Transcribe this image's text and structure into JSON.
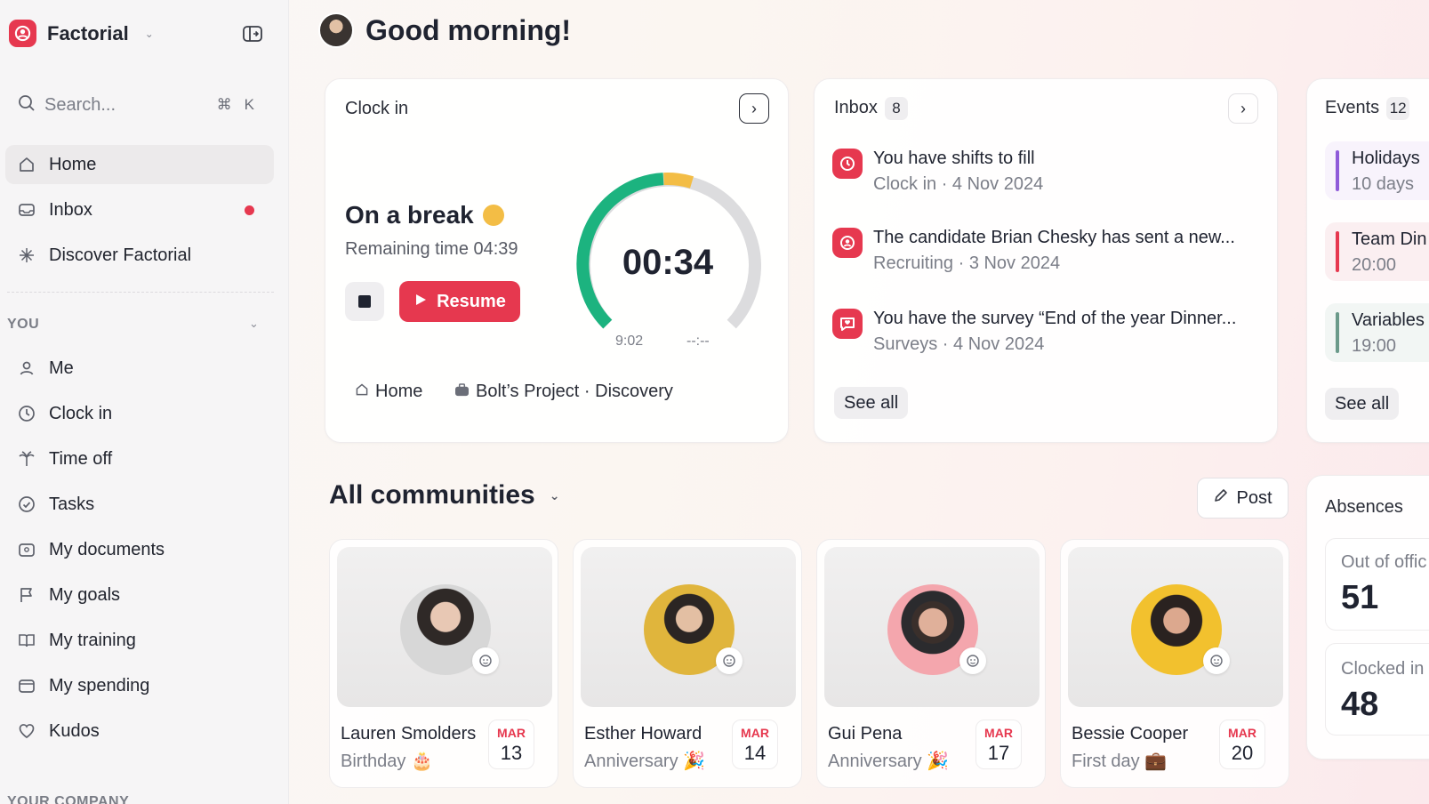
{
  "sidebar": {
    "brand": "Factorial",
    "search": {
      "placeholder": "Search...",
      "shortcut_cmd": "⌘",
      "shortcut_key": "K"
    },
    "nav": [
      {
        "label": "Home",
        "icon": "home-icon"
      },
      {
        "label": "Inbox",
        "icon": "inbox-icon"
      },
      {
        "label": "Discover Factorial",
        "icon": "sparkles-icon"
      }
    ],
    "section_you": "YOU",
    "you_items": [
      {
        "label": "Me",
        "icon": "person-icon"
      },
      {
        "label": "Clock in",
        "icon": "clock-icon"
      },
      {
        "label": "Time off",
        "icon": "palm-tree-icon"
      },
      {
        "label": "Tasks",
        "icon": "check-circle-icon"
      },
      {
        "label": "My documents",
        "icon": "documents-icon"
      },
      {
        "label": "My goals",
        "icon": "flag-icon"
      },
      {
        "label": "My training",
        "icon": "book-icon"
      },
      {
        "label": "My spending",
        "icon": "wallet-icon"
      },
      {
        "label": "Kudos",
        "icon": "heart-icon"
      }
    ],
    "section_company": "YOUR COMPANY"
  },
  "header": {
    "greeting": "Good morning!"
  },
  "clock_card": {
    "title": "Clock in",
    "status": "On a break",
    "remaining": "Remaining time 04:39",
    "resume_label": "Resume",
    "timer": "00:34",
    "tick_start": "9:02",
    "tick_end": "--:--",
    "location": "Home",
    "project": "Bolt’s Project · Discovery"
  },
  "inbox_card": {
    "title": "Inbox",
    "count": "8",
    "items": [
      {
        "title": "You have shifts to fill",
        "sub": "Clock in · 4 Nov 2024",
        "icon": "clock-icon"
      },
      {
        "title": "The candidate Brian Chesky has sent a new...",
        "sub": "Recruiting · 3 Nov 2024",
        "icon": "candidate-icon"
      },
      {
        "title": "You have the survey “End of the year Dinner...",
        "sub": "Surveys · 4 Nov 2024",
        "icon": "survey-icon"
      }
    ],
    "see_all": "See all"
  },
  "events_card": {
    "title": "Events",
    "count": "12",
    "items": [
      {
        "title": "Holidays",
        "sub": "10 days",
        "color": "#8f5bd9"
      },
      {
        "title": "Team Din",
        "sub": "20:00",
        "color": "#e6384f"
      },
      {
        "title": "Variables",
        "sub": "19:00",
        "color": "#6b9a8a"
      }
    ],
    "see_all": "See all"
  },
  "communities": {
    "title": "All communities",
    "post_label": "Post",
    "cards": [
      {
        "name": "Lauren Smolders",
        "event": "Birthday",
        "event_icon": "cake-icon",
        "month": "MAR",
        "day": "13"
      },
      {
        "name": "Esther Howard",
        "event": "Anniversary",
        "event_icon": "party-popper-icon",
        "month": "MAR",
        "day": "14"
      },
      {
        "name": "Gui Pena",
        "event": "Anniversary",
        "event_icon": "party-popper-icon",
        "month": "MAR",
        "day": "17"
      },
      {
        "name": "Bessie Cooper",
        "event": "First day",
        "event_icon": "briefcase-icon",
        "month": "MAR",
        "day": "20"
      }
    ]
  },
  "absences": {
    "title": "Absences",
    "out_of_office_label": "Out of offic",
    "out_of_office_value": "51",
    "clocked_in_label": "Clocked in",
    "clocked_in_value": "48"
  },
  "colors": {
    "brand": "#e6384f",
    "progress": "#1cb37f",
    "break": "#f3bd45"
  }
}
